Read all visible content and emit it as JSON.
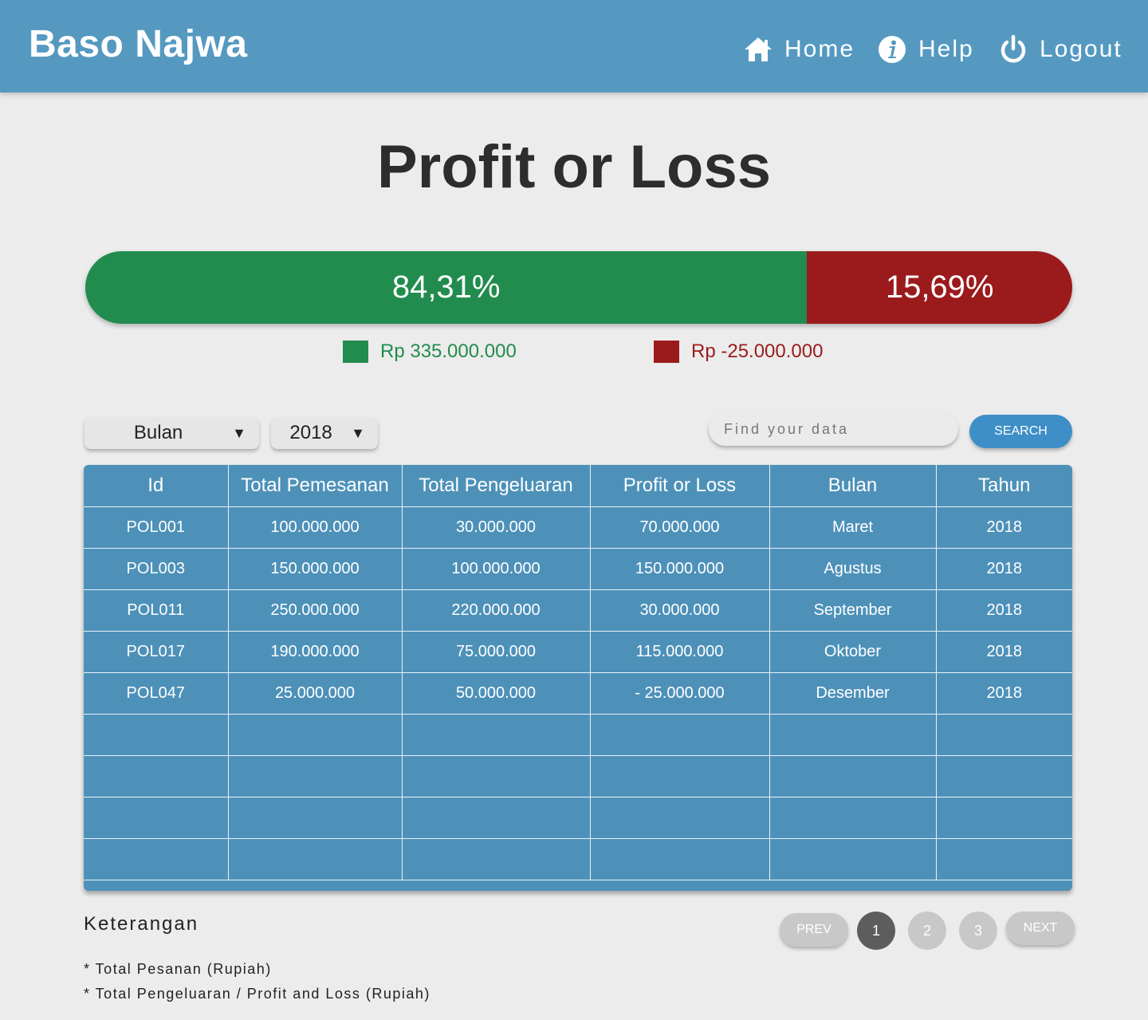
{
  "header": {
    "brand": "Baso Najwa",
    "nav": [
      {
        "label": "Home",
        "icon": "home-icon"
      },
      {
        "label": "Help",
        "icon": "info-icon"
      },
      {
        "label": "Logout",
        "icon": "power-icon"
      }
    ]
  },
  "page_title": "Profit or Loss",
  "summary": {
    "profit_percent_label": "84,31%",
    "loss_percent_label": "15,69%",
    "profit_fraction": 0.7313,
    "profit_color": "#218c4e",
    "loss_color": "#9b1b1d",
    "profit_amount": "Rp 335.000.000",
    "loss_amount": "Rp -25.000.000"
  },
  "filters": {
    "month_value": "Bulan",
    "year_value": "2018",
    "search_placeholder": "Find your data",
    "search_button": "SEARCH"
  },
  "table": {
    "headers": [
      "Id",
      "Total Pemesanan",
      "Total Pengeluaran",
      "Profit or Loss",
      "Bulan",
      "Tahun"
    ],
    "rows": [
      [
        "POL001",
        "100.000.000",
        "30.000.000",
        "70.000.000",
        "Maret",
        "2018"
      ],
      [
        "POL003",
        "150.000.000",
        "100.000.000",
        "150.000.000",
        "Agustus",
        "2018"
      ],
      [
        "POL011",
        "250.000.000",
        "220.000.000",
        "30.000.000",
        "September",
        "2018"
      ],
      [
        "POL017",
        "190.000.000",
        "75.000.000",
        "115.000.000",
        "Oktober",
        "2018"
      ],
      [
        "POL047",
        "25.000.000",
        "50.000.000",
        "- 25.000.000",
        "Desember",
        "2018"
      ]
    ],
    "empty_rows": 4,
    "header_color": "#4d91b9"
  },
  "notes": {
    "title": "Keterangan",
    "lines": [
      "* Total Pesanan (Rupiah)",
      "* Total Pengeluaran / Profit and Loss (Rupiah)"
    ]
  },
  "pagination": {
    "prev": "PREV",
    "next": "NEXT",
    "pages": [
      "1",
      "2",
      "3"
    ],
    "current": "1"
  }
}
